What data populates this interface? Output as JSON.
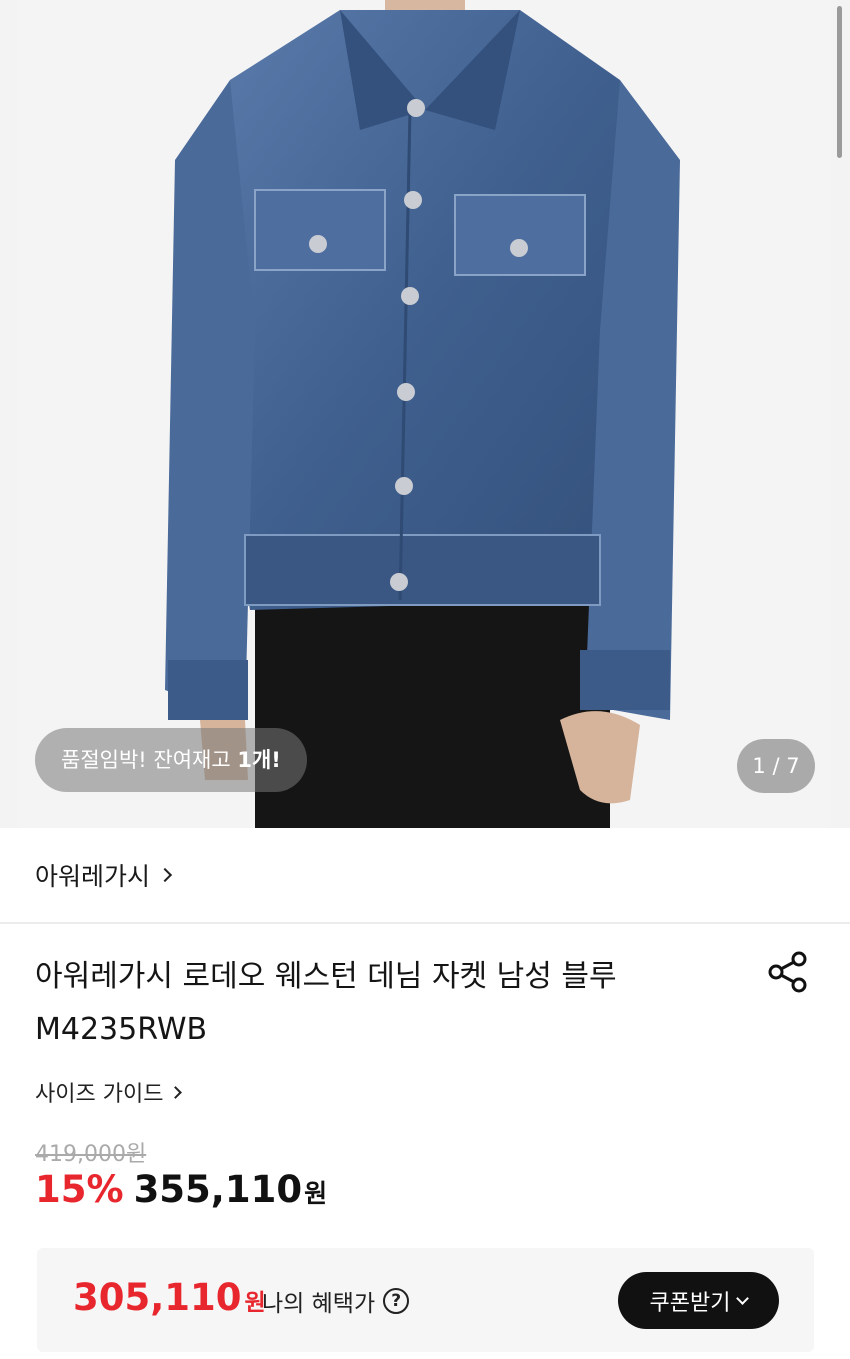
{
  "gallery": {
    "stock_message": "품절임박! 잔여재고 ",
    "stock_count": "1개!",
    "page_counter": "1 / 7"
  },
  "brand": {
    "name": "아워레가시"
  },
  "product": {
    "title": "아워레가시 로데오 웨스턴 데님 자켓 남성 블루 M4235RWB",
    "size_guide": "사이즈 가이드"
  },
  "price": {
    "original": "419,000원",
    "discount": "15%",
    "sale": "355,110",
    "currency": "원"
  },
  "benefit": {
    "price": "305,110",
    "currency": "원",
    "label": "나의 혜택가",
    "coupon_button": "쿠폰받기"
  },
  "colors": {
    "accent_red": "#e8262d",
    "denim": "#3f5f8e"
  },
  "icons": [
    "share-icon",
    "question-icon",
    "chevron-right-icon",
    "chevron-down-icon"
  ]
}
